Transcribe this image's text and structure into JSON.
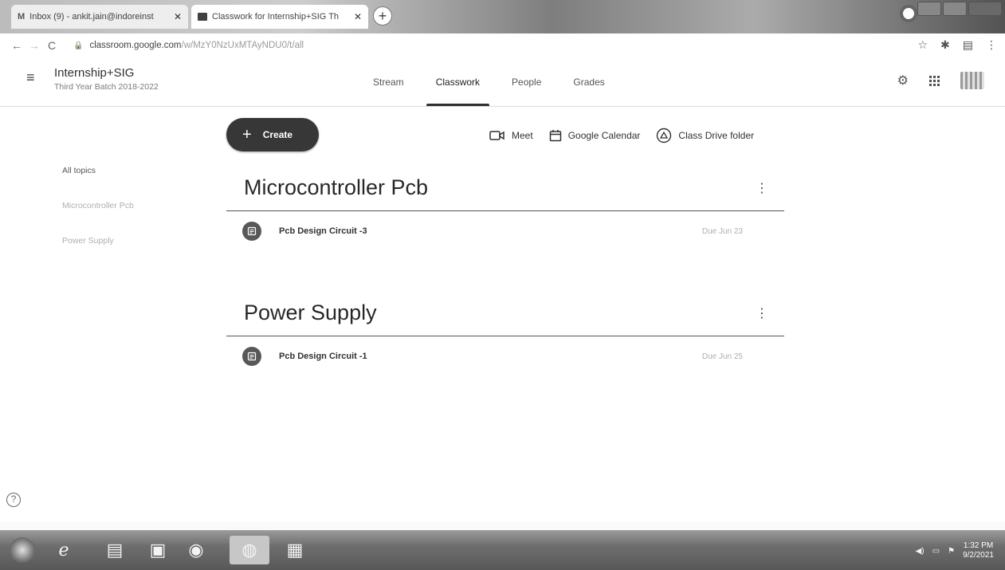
{
  "browser": {
    "tabs": [
      {
        "title": "Inbox (9) - ankit.jain@indoreinst",
        "favicon": "gmail-icon",
        "active": false
      },
      {
        "title": "Classwork for Internship+SIG Th",
        "favicon": "classroom-icon",
        "active": true
      }
    ],
    "url_host": "classroom.google.com",
    "url_path": "/w/MzY0NzUxMTAyNDU0/t/all"
  },
  "header": {
    "class_name": "Internship+SIG",
    "class_subtitle": "Third Year Batch 2018-2022",
    "tabs": [
      {
        "label": "Stream",
        "active": false
      },
      {
        "label": "Classwork",
        "active": true
      },
      {
        "label": "People",
        "active": false
      },
      {
        "label": "Grades",
        "active": false
      }
    ]
  },
  "toolbar": {
    "create_label": "Create",
    "meet_label": "Meet",
    "calendar_label": "Google Calendar",
    "drive_label": "Class Drive folder"
  },
  "topics": [
    {
      "label": "All topics",
      "active": true
    },
    {
      "label": "Microcontroller Pcb",
      "active": false
    },
    {
      "label": "Power Supply",
      "active": false
    }
  ],
  "sections": [
    {
      "title": "Microcontroller Pcb",
      "items": [
        {
          "title": "Pcb Design Circuit -3",
          "due": "Due Jun 23"
        }
      ]
    },
    {
      "title": "Power Supply",
      "items": [
        {
          "title": "Pcb Design Circuit -1",
          "due": "Due Jun 25"
        }
      ]
    }
  ],
  "taskbar": {
    "time": "1:32 PM",
    "date": "9/2/2021"
  }
}
